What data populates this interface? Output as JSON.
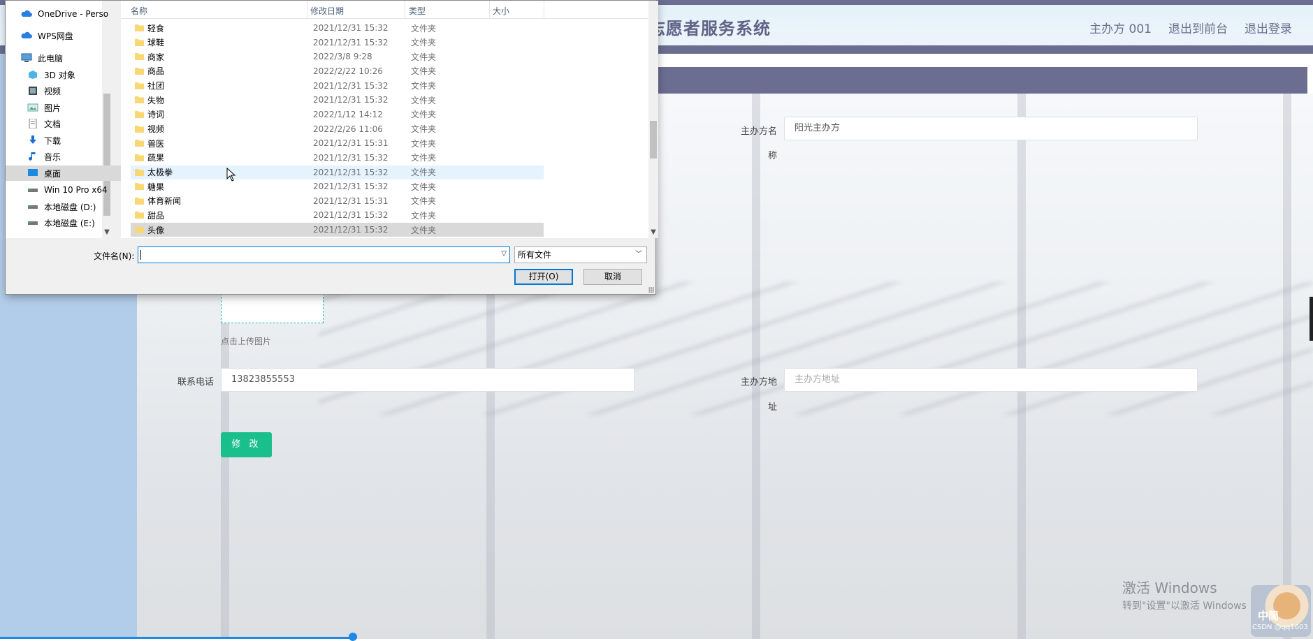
{
  "app": {
    "title": "志愿者服务系统",
    "header_links": [
      "主办方 001",
      "退出到前台",
      "退出登录"
    ],
    "form": {
      "org_name_label_line1": "主办方名",
      "org_name_label_line2": "称",
      "org_name_value": "阳光主办方",
      "upload_hint": "点击上传图片",
      "phone_label": "联系电话",
      "phone_value": "13823855553",
      "address_label_line1": "主办方地",
      "address_label_line2": "址",
      "address_placeholder": "主办方地址",
      "submit_label": "修 改"
    },
    "watermark_line1": "激活 Windows",
    "watermark_line2": "转到\"设置\"以激活 Windows",
    "avatar_text1": "中简",
    "avatar_text2": "CSDN @qq1603"
  },
  "dialog": {
    "nav_items": [
      {
        "label": "OneDrive - Perso",
        "icon": "cloud-icon"
      },
      {
        "label": "WPS网盘",
        "icon": "cloud-icon"
      },
      {
        "label": "此电脑",
        "icon": "pc-icon"
      },
      {
        "label": "3D 对象",
        "icon": "cube-icon"
      },
      {
        "label": "视频",
        "icon": "video-icon"
      },
      {
        "label": "图片",
        "icon": "picture-icon"
      },
      {
        "label": "文档",
        "icon": "document-icon"
      },
      {
        "label": "下载",
        "icon": "download-icon"
      },
      {
        "label": "音乐",
        "icon": "music-icon"
      },
      {
        "label": "桌面",
        "icon": "desktop-icon"
      },
      {
        "label": "Win 10 Pro x64",
        "icon": "drive-icon"
      },
      {
        "label": "本地磁盘 (D:)",
        "icon": "drive-icon"
      },
      {
        "label": "本地磁盘 (E:)",
        "icon": "drive-icon"
      }
    ],
    "columns": {
      "name": "名称",
      "date": "修改日期",
      "type": "类型",
      "size": "大小"
    },
    "files": [
      {
        "name": "轻食",
        "date": "2021/12/31 15:32",
        "type": "文件夹"
      },
      {
        "name": "球鞋",
        "date": "2021/12/31 15:32",
        "type": "文件夹"
      },
      {
        "name": "商家",
        "date": "2022/3/8 9:28",
        "type": "文件夹"
      },
      {
        "name": "商品",
        "date": "2022/2/22 10:26",
        "type": "文件夹"
      },
      {
        "name": "社团",
        "date": "2021/12/31 15:32",
        "type": "文件夹"
      },
      {
        "name": "失物",
        "date": "2021/12/31 15:32",
        "type": "文件夹"
      },
      {
        "name": "诗词",
        "date": "2022/1/12 14:12",
        "type": "文件夹"
      },
      {
        "name": "视频",
        "date": "2022/2/26 11:06",
        "type": "文件夹"
      },
      {
        "name": "兽医",
        "date": "2021/12/31 15:31",
        "type": "文件夹"
      },
      {
        "name": "蔬果",
        "date": "2021/12/31 15:32",
        "type": "文件夹"
      },
      {
        "name": "太极拳",
        "date": "2021/12/31 15:32",
        "type": "文件夹"
      },
      {
        "name": "糖果",
        "date": "2021/12/31 15:32",
        "type": "文件夹"
      },
      {
        "name": "体育新闻",
        "date": "2021/12/31 15:31",
        "type": "文件夹"
      },
      {
        "name": "甜品",
        "date": "2021/12/31 15:32",
        "type": "文件夹"
      },
      {
        "name": "头像",
        "date": "2021/12/31 15:32",
        "type": "文件夹"
      }
    ],
    "filename_label": "文件名(N):",
    "filename_value": "",
    "filter_value": "所有文件",
    "open_label": "打开(O)",
    "cancel_label": "取消",
    "accent_color": "#0078d7",
    "folder_color": "#f8d775"
  }
}
